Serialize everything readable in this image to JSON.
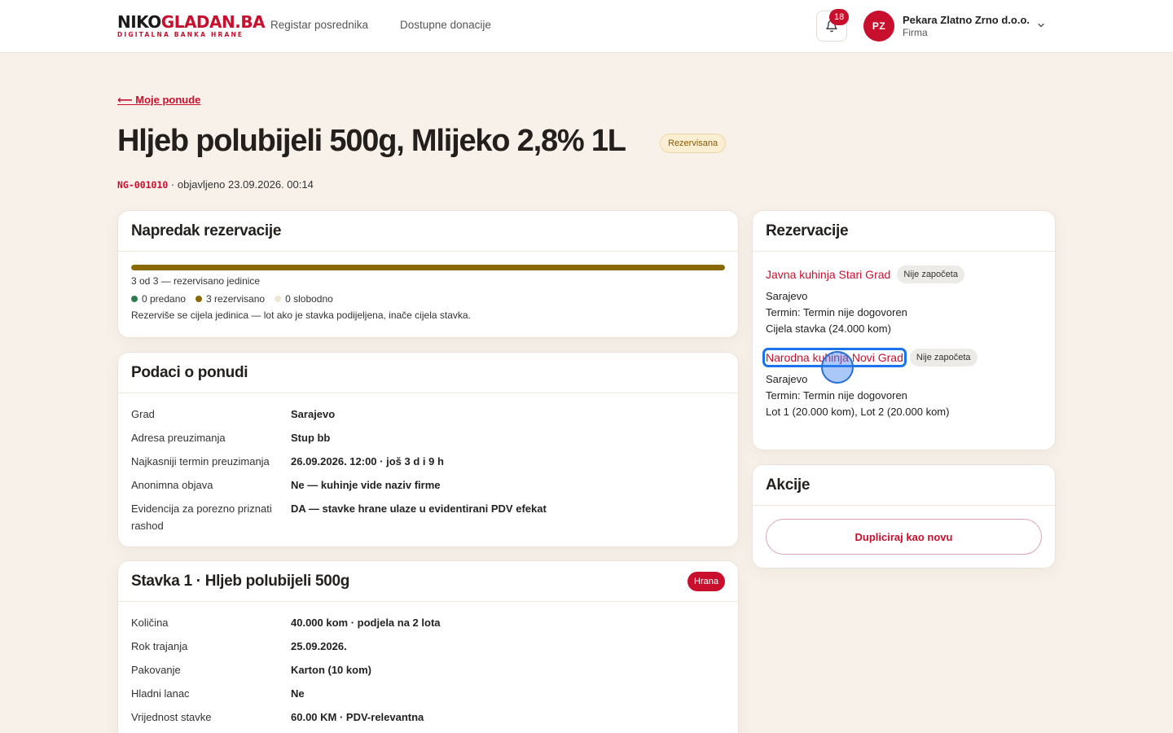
{
  "header": {
    "logo_main_dark": "NIKO",
    "logo_main_red": "GLADAN.BA",
    "logo_sub": "DIGITALNA BANKA HRANE",
    "nav": [
      "Registar posrednika",
      "Dostupne donacije"
    ],
    "notifications_count": "18",
    "user": {
      "initials": "PZ",
      "name": "Pekara Zlatno Zrno d.o.o.",
      "role": "Firma"
    }
  },
  "page": {
    "back_link": "⟵ Moje ponude",
    "title": "Hljeb polubijeli 500g, Mlijeko 2,8% 1L",
    "status": "Rezervisana",
    "code": "NG-001010",
    "published": " · objavljeno 23.09.2026. 00:14"
  },
  "progress_card": {
    "title": "Napredak rezervacije",
    "progress_fraction": 1.0,
    "summary": "3 od 3 — rezervisano jedinice",
    "legend": [
      {
        "label": "0 predano",
        "color": "#2e7d4f"
      },
      {
        "label": "3 rezervisano",
        "color": "#8a6a00"
      },
      {
        "label": "0 slobodno",
        "color": "#f1e6d4"
      }
    ],
    "note": "Rezerviše se cijela jedinica — lot ako je stavka podijeljena, inače cijela stavka."
  },
  "offer_card": {
    "title": "Podaci o ponudi",
    "rows": [
      {
        "key": "Grad",
        "value": "Sarajevo"
      },
      {
        "key": "Adresa preuzimanja",
        "value": "Stup bb"
      },
      {
        "key": "Najkasniji termin preuzimanja",
        "value": "26.09.2026. 12:00 · još 3 d i 9 h"
      },
      {
        "key": "Anonimna objava",
        "value": "Ne — kuhinje vide naziv firme"
      },
      {
        "key": "Evidencija za porezno priznati rashod",
        "value": "DA — stavke hrane ulaze u evidentirani PDV efekat"
      }
    ]
  },
  "item_card": {
    "title": "Stavka 1 · Hljeb polubijeli 500g",
    "badge": "Hrana",
    "rows": [
      {
        "key": "Količina",
        "value": "40.000 kom · podjela na 2 lota"
      },
      {
        "key": "Rok trajanja",
        "value": "25.09.2026."
      },
      {
        "key": "Pakovanje",
        "value": "Karton (10 kom)"
      },
      {
        "key": "Hladni lanac",
        "value": "Ne"
      },
      {
        "key": "Vrijednost stavke",
        "value": "60.00 KM · PDV-relevantna"
      }
    ]
  },
  "reservations_card": {
    "title": "Rezervacije",
    "items": [
      {
        "name": "Javna kuhinja Stari Grad",
        "status": "Nije započeta",
        "city": "Sarajevo",
        "term": "Termin: Termin nije dogovoren",
        "detail": "Cijela stavka (24.000 kom)"
      },
      {
        "name": "Narodna kuhinja Novi Grad",
        "status": "Nije započeta",
        "city": "Sarajevo",
        "term": "Termin: Termin nije dogovoren",
        "detail": "Lot 1 (20.000 kom), Lot 2 (20.000 kom)"
      }
    ]
  },
  "actions_card": {
    "title": "Akcije",
    "duplicate_button": "Dupliciraj kao novu"
  }
}
